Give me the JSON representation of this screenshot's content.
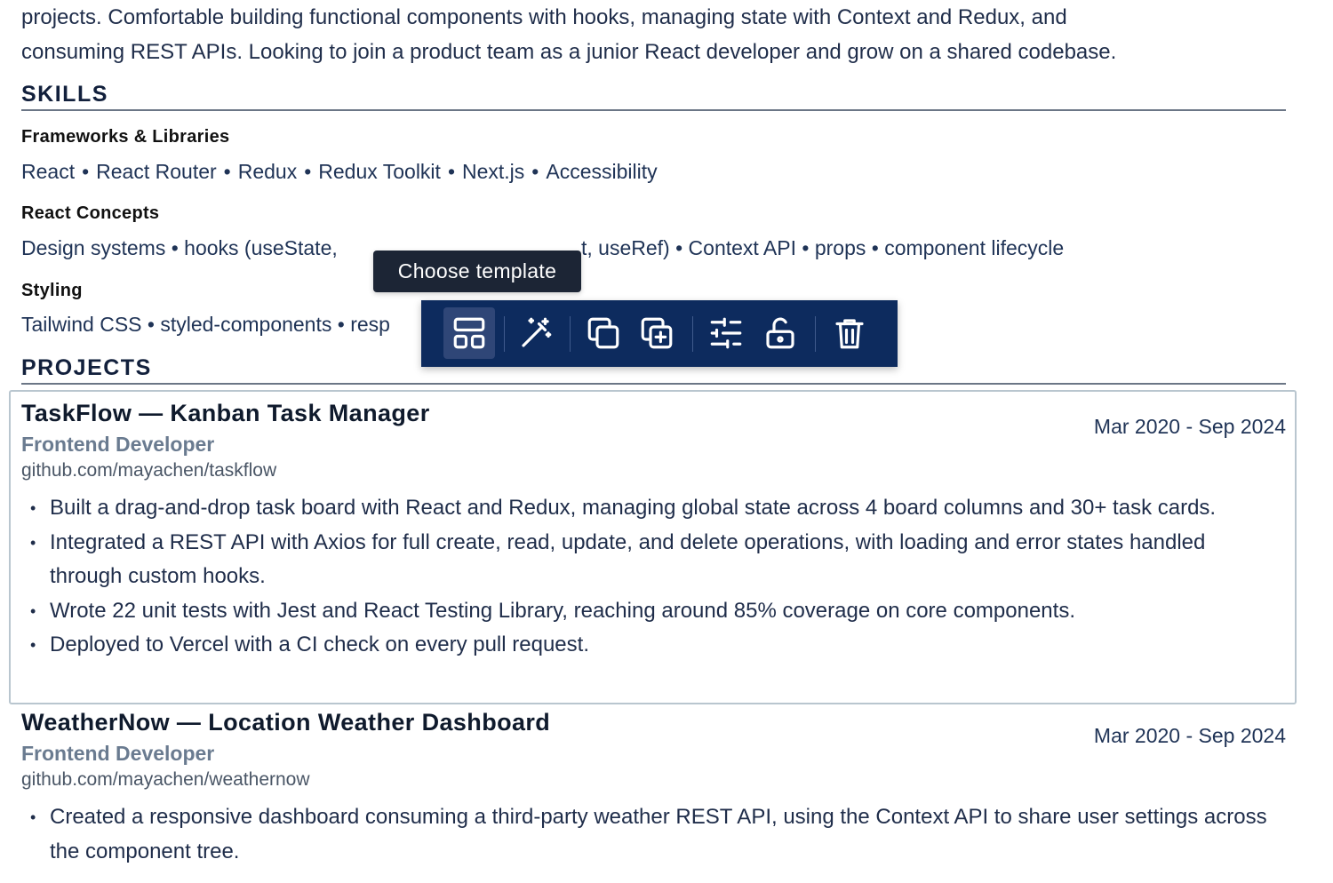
{
  "summary": {
    "lines": [
      "projects. Comfortable building functional components with hooks, managing state with Context and Redux, and",
      "consuming REST APIs. Looking to join a product team as a junior React developer and grow on a shared codebase."
    ]
  },
  "skills": {
    "title": "SKILLS",
    "groups": [
      {
        "heading": "Frameworks & Libraries",
        "items": [
          "React",
          "React Router",
          "Redux",
          "Redux Toolkit",
          "Next.js",
          "Accessibility"
        ]
      },
      {
        "heading": "React Concepts",
        "visible_start": "Design systems • hooks (useState, ",
        "visible_end": "t, useRef) • Context API • props • component lifecycle"
      },
      {
        "heading": "Styling",
        "visible_start": "Tailwind CSS • styled-components • resp"
      }
    ]
  },
  "tooltip": {
    "text": "Choose template"
  },
  "toolbar": {
    "buttons": [
      {
        "icon": "layout-template-icon",
        "active": true
      },
      {
        "icon": "magic-wand-icon"
      },
      {
        "icon": "copy-icon"
      },
      {
        "icon": "duplicate-add-icon"
      },
      {
        "icon": "sliders-settings-icon"
      },
      {
        "icon": "unlock-icon"
      },
      {
        "icon": "trash-icon"
      }
    ],
    "colors": {
      "background": "#0d2b5e",
      "active": "#2f4677",
      "icon": "#ffffff"
    }
  },
  "projects": {
    "title": "PROJECTS",
    "items": [
      {
        "name": "TaskFlow — Kanban Task Manager",
        "dates": "Mar 2020 - Sep 2024",
        "role": "Frontend Developer",
        "link": "github.com/mayachen/taskflow",
        "bullets": [
          "Built a drag-and-drop task board with React and Redux, managing global state across 4 board columns and 30+ task cards.",
          "Integrated a REST API with Axios for full create, read, update, and delete operations, with loading and error states handled through custom hooks.",
          "Wrote 22 unit tests with Jest and React Testing Library, reaching around 85% coverage on core components.",
          "Deployed to Vercel with a CI check on every pull request."
        ]
      },
      {
        "name": "WeatherNow — Location Weather Dashboard",
        "dates": "Mar 2020 - Sep 2024",
        "role": "Frontend Developer",
        "link": "github.com/mayachen/weathernow",
        "bullets": [
          "Created a responsive dashboard consuming a third-party weather REST API, using the Context API to share user settings across the component tree."
        ]
      }
    ]
  }
}
